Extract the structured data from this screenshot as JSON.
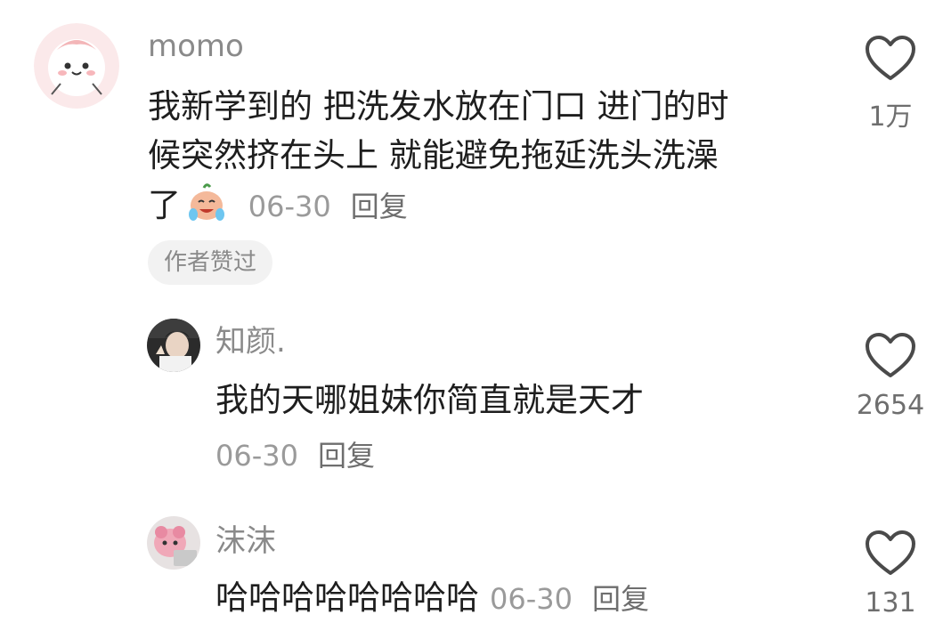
{
  "comments": [
    {
      "username": "momo",
      "text_lines": [
        "我新学到的 把洗发水放在门口 进门的时",
        "候突然挤在头上 就能避免拖延洗头洗澡",
        "了"
      ],
      "emoji": "crying-laughing-emoji",
      "date": "06-30",
      "reply_label": "回复",
      "badge": "作者赞过",
      "likes": "1万"
    },
    {
      "username": "知颜.",
      "text": "我的天哪姐妹你简直就是天才",
      "date": "06-30",
      "reply_label": "回复",
      "likes": "2654"
    },
    {
      "username": "沫沫",
      "text": "哈哈哈哈哈哈哈哈",
      "date": "06-30",
      "reply_label": "回复",
      "likes": "131"
    }
  ],
  "icons": {
    "like": "heart-outline-icon"
  },
  "colors": {
    "name": "#8a8a8a",
    "text": "#1e1e1e",
    "meta": "#9a9a9a",
    "badge_bg": "#f2f2f2"
  }
}
